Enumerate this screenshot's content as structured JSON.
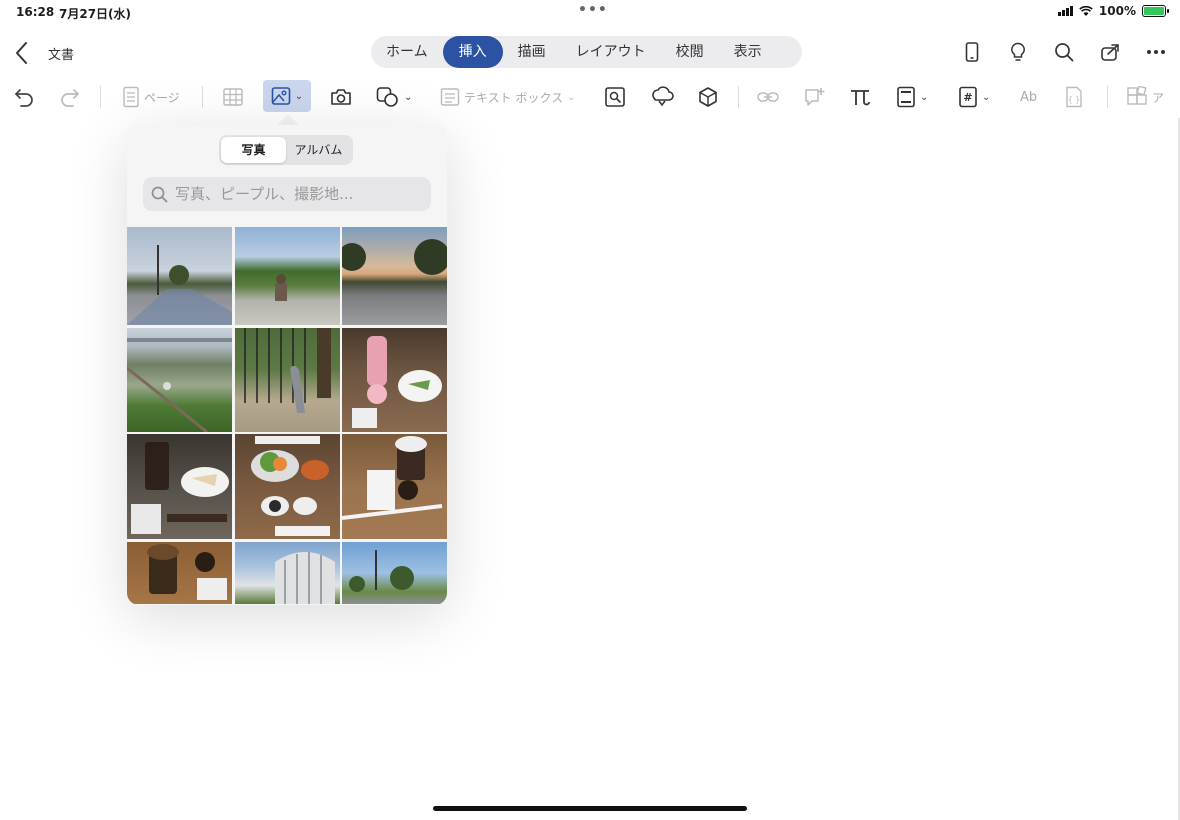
{
  "status": {
    "time": "16:28",
    "date": "7月27日(水)",
    "battery": "100%"
  },
  "titlebar": {
    "doc_title": "文書",
    "tabs": [
      {
        "label": "ホーム",
        "active": false
      },
      {
        "label": "挿入",
        "active": true
      },
      {
        "label": "描画",
        "active": false
      },
      {
        "label": "レイアウト",
        "active": false
      },
      {
        "label": "校閲",
        "active": false
      },
      {
        "label": "表示",
        "active": false
      }
    ]
  },
  "toolbar": {
    "page_label": "ページ",
    "textbox_label": "テキスト ボックス",
    "ab_label": "Ab",
    "a_label": "ア"
  },
  "photo_picker": {
    "segments": [
      {
        "label": "写真",
        "active": true
      },
      {
        "label": "アルバム",
        "active": false
      }
    ],
    "search_placeholder": "写真、ピープル、撮影地..."
  },
  "colors": {
    "accent": "#2b52a3",
    "selected_tool_bg": "#c9d6ee"
  }
}
